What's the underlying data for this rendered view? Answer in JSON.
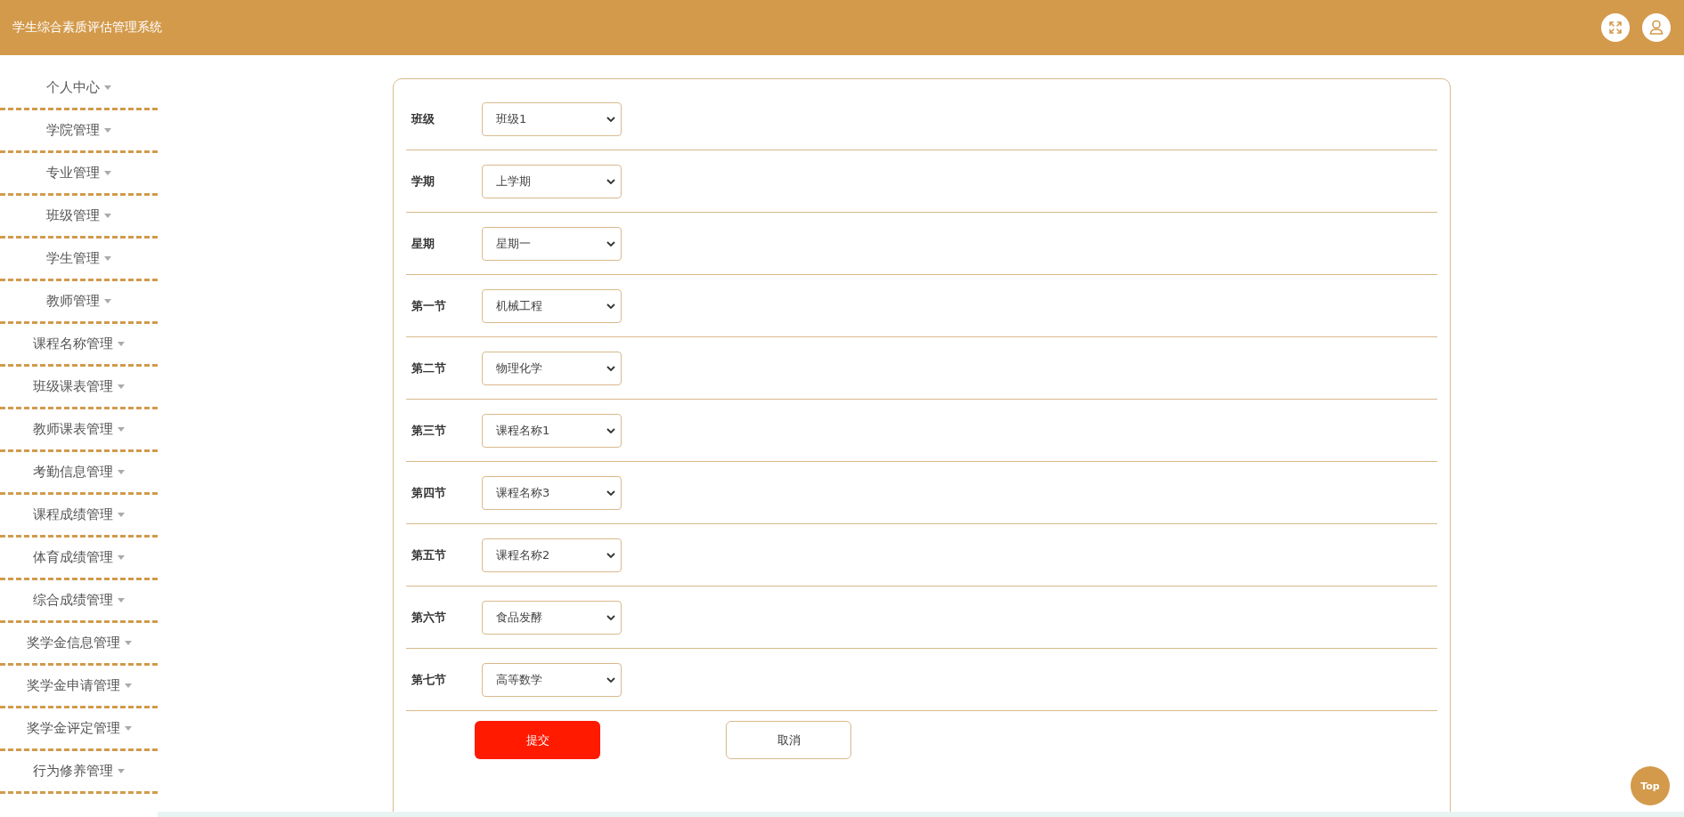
{
  "header": {
    "title": "学生综合素质评估管理系统"
  },
  "sidebar": {
    "items": [
      {
        "label": "个人中心"
      },
      {
        "label": "学院管理"
      },
      {
        "label": "专业管理"
      },
      {
        "label": "班级管理"
      },
      {
        "label": "学生管理"
      },
      {
        "label": "教师管理"
      },
      {
        "label": "课程名称管理"
      },
      {
        "label": "班级课表管理"
      },
      {
        "label": "教师课表管理"
      },
      {
        "label": "考勤信息管理"
      },
      {
        "label": "课程成绩管理"
      },
      {
        "label": "体育成绩管理"
      },
      {
        "label": "综合成绩管理"
      },
      {
        "label": "奖学金信息管理"
      },
      {
        "label": "奖学金申请管理"
      },
      {
        "label": "奖学金评定管理"
      },
      {
        "label": "行为修养管理"
      }
    ]
  },
  "form": {
    "fields": [
      {
        "label": "班级",
        "value": "班级1"
      },
      {
        "label": "学期",
        "value": "上学期"
      },
      {
        "label": "星期",
        "value": "星期一"
      },
      {
        "label": "第一节",
        "value": "机械工程"
      },
      {
        "label": "第二节",
        "value": "物理化学"
      },
      {
        "label": "第三节",
        "value": "课程名称1"
      },
      {
        "label": "第四节",
        "value": "课程名称3"
      },
      {
        "label": "第五节",
        "value": "课程名称2"
      },
      {
        "label": "第六节",
        "value": "食品发酵"
      },
      {
        "label": "第七节",
        "value": "高等数学"
      }
    ],
    "buttons": [
      {
        "label": "提交",
        "kind": "primary"
      },
      {
        "label": "取消",
        "kind": "secondary"
      }
    ]
  },
  "top_button": {
    "label": "Top"
  }
}
